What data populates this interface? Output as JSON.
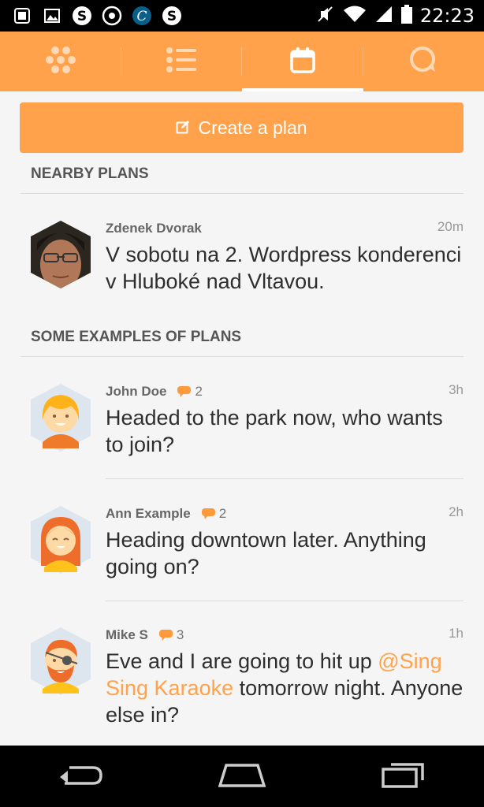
{
  "status_bar": {
    "time": "22:23",
    "left_icons": [
      "sim-card-icon",
      "picture-icon",
      "s-app-icon",
      "circle-dot-icon",
      "c-app-icon",
      "s-app-icon"
    ],
    "right_icons": [
      "mute-icon",
      "wifi-icon",
      "signal-icon",
      "battery-icon"
    ]
  },
  "tabs": [
    {
      "icon": "hexagons-icon",
      "active": false
    },
    {
      "icon": "list-icon",
      "active": false
    },
    {
      "icon": "calendar-icon",
      "active": true
    },
    {
      "icon": "chat-bubble-icon",
      "active": false
    }
  ],
  "create_button": {
    "label": "Create a plan",
    "icon": "edit-icon"
  },
  "sections": {
    "nearby": "NEARBY PLANS",
    "examples": "SOME EXAMPLES OF PLANS"
  },
  "nearby_plans": [
    {
      "name": "Zdenek Dvorak",
      "time": "20m",
      "message": "V sobotu na 2. Wordpress konderenci v Hluboké nad Vltavou."
    }
  ],
  "example_plans": [
    {
      "name": "John Doe",
      "comments": "2",
      "time": "3h",
      "message": "Headed to the park now, who wants to join?"
    },
    {
      "name": "Ann Example",
      "comments": "2",
      "time": "2h",
      "message": "Heading downtown later. Anything going on?"
    },
    {
      "name": "Mike S",
      "comments": "3",
      "time": "1h",
      "message_pre": "Eve and I are going to hit up ",
      "mention": "@Sing Sing Karaoke",
      "message_post": " tomorrow night. Anyone else in?"
    }
  ],
  "colors": {
    "accent": "#ffa24b",
    "text": "#2e2e2e",
    "muted": "#999999"
  },
  "nav": [
    "back-icon",
    "home-icon",
    "recent-apps-icon"
  ]
}
